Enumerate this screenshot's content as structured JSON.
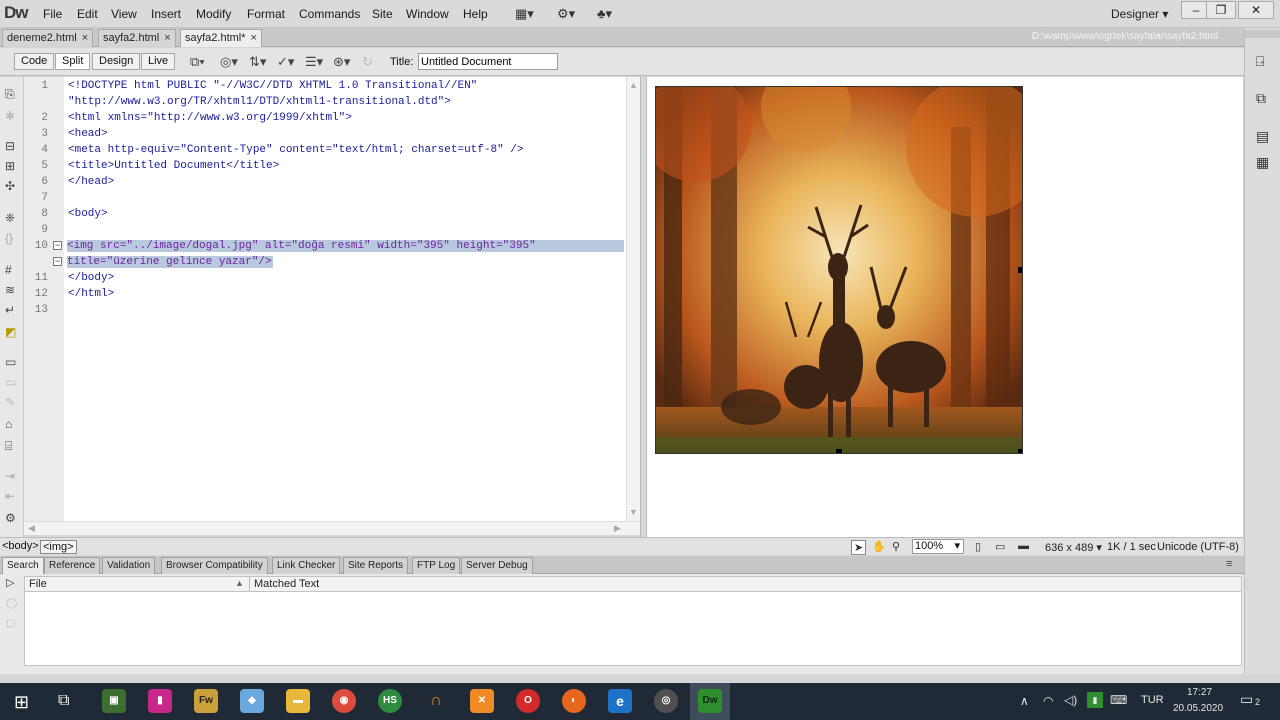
{
  "app": {
    "logo": "Dw",
    "menus": [
      "File",
      "Edit",
      "View",
      "Insert",
      "Modify",
      "Format",
      "Commands",
      "Site",
      "Window",
      "Help"
    ],
    "workspace": "Designer",
    "window_buttons": [
      "–",
      "❐",
      "✕"
    ]
  },
  "tabs": [
    {
      "label": "deneme2.html",
      "close": "×"
    },
    {
      "label": "sayfa2.html",
      "close": "×"
    },
    {
      "label": "sayfa2.html*",
      "close": "×"
    }
  ],
  "doc_path": "D:\\wamp\\www\\ogrtek\\sayfalar\\sayfa2.html",
  "toolbar": {
    "code_label": "Code",
    "split_label": "Split",
    "design_label": "Design",
    "live_label": "Live",
    "title_label": "Title:",
    "title_value": "Untitled Document"
  },
  "code_lines": [
    {
      "num": "1",
      "text": "<!DOCTYPE html PUBLIC \"-//W3C//DTD XHTML 1.0 Transitional//EN\""
    },
    {
      "num": "",
      "text": "\"http://www.w3.org/TR/xhtml1/DTD/xhtml1-transitional.dtd\">"
    },
    {
      "num": "2",
      "text": "<html xmlns=\"http://www.w3.org/1999/xhtml\">"
    },
    {
      "num": "3",
      "text": "<head>"
    },
    {
      "num": "4",
      "text": "<meta http-equiv=\"Content-Type\" content=\"text/html; charset=utf-8\" />"
    },
    {
      "num": "5",
      "text": "<title>Untitled Document</title>"
    },
    {
      "num": "6",
      "text": "</head>"
    },
    {
      "num": "7",
      "text": ""
    },
    {
      "num": "8",
      "text": "<body>"
    },
    {
      "num": "9",
      "text": ""
    },
    {
      "num": "10",
      "text": "<img src=\"../image/dogal.jpg\" alt=\"doğa resmi\" width=\"395\" height=\"395\""
    },
    {
      "num": "",
      "text": "title=\"üzerine gelince yazar\"/>"
    },
    {
      "num": "11",
      "text": "</body>"
    },
    {
      "num": "12",
      "text": "</html>"
    },
    {
      "num": "13",
      "text": ""
    }
  ],
  "design": {
    "image_alt": "doğa resmi"
  },
  "status": {
    "tag_body": "<body>",
    "tag_img": "<img>",
    "zoom": "100%",
    "dimensions": "636 x 489 ▾",
    "download": "1K / 1 sec",
    "encoding": "Unicode (UTF-8)"
  },
  "results": {
    "tabs": [
      "Search",
      "Reference",
      "Validation",
      "Browser Compatibility",
      "Link Checker",
      "Site Reports",
      "FTP Log",
      "Server Debug"
    ],
    "col_file": "File",
    "col_matched": "Matched Text"
  },
  "taskbar": {
    "language": "TUR",
    "time": "17:27",
    "date": "20.05.2020",
    "notifications": "2"
  },
  "colors": {
    "selection": "#b8c9dd",
    "code_tag": "#1b1b9a",
    "code_selected": "#6d24a0",
    "taskbar": "#1f2a36",
    "dw_app_icon": "#2f8f2f"
  }
}
